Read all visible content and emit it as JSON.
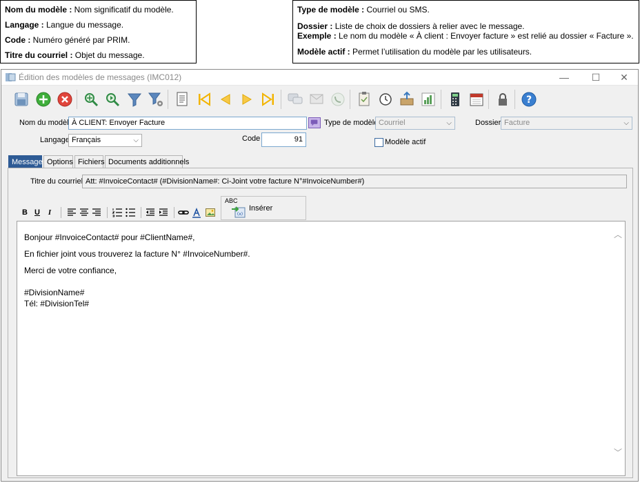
{
  "callouts": {
    "left": [
      {
        "term": "Nom du modèle :",
        "text": " Nom significatif du modèle."
      },
      {
        "term": "Langage :",
        "text": " Langue du message."
      },
      {
        "term": "Code :",
        "text": " Numéro généré par PRIM."
      },
      {
        "term": "Titre du courriel :",
        "text": " Objet du message."
      }
    ],
    "right": [
      {
        "term": "Type de modèle :",
        "text": " Courriel ou SMS."
      },
      {
        "term": "Dossier :",
        "text": " Liste de choix de dossiers à relier avec le message."
      },
      {
        "term": "Exemple :",
        "text": " Le nom du modèle « À client : Envoyer facture » est relié au dossier « Facture »."
      },
      {
        "term": "Modèle actif :",
        "text": " Permet l’utilisation du modèle par les utilisateurs."
      }
    ]
  },
  "window": {
    "title": "Édition des modèles de messages (IMC012)",
    "controls": {
      "minimize": "—",
      "maximize": "☐",
      "close": "✕"
    }
  },
  "toolbar": {
    "buttons": [
      "save-icon",
      "add-icon",
      "delete-icon",
      "search-icon",
      "search-next-icon",
      "filter-icon",
      "filter-settings-icon",
      "report-icon",
      "first-record-icon",
      "previous-record-icon",
      "next-record-icon",
      "last-record-icon",
      "message-icon",
      "email-icon",
      "phone-icon",
      "clipboard-icon",
      "history-icon",
      "export-icon",
      "chart-icon",
      "calculator-icon",
      "calendar-icon",
      "lock-icon",
      "help-icon"
    ]
  },
  "form": {
    "nom_label": "Nom du modèle",
    "nom_value": "À CLIENT: Envoyer Facture",
    "langage_label": "Langage",
    "langage_value": "Français",
    "code_label": "Code",
    "code_value": "91",
    "type_label": "Type de modèle",
    "type_value": "Courriel",
    "dossier_label": "Dossier",
    "dossier_value": "Facture",
    "actif_label": "Modèle actif",
    "actif_checked": false
  },
  "tabs": [
    "Message",
    "Options",
    "Fichiers",
    "Documents additionnels"
  ],
  "message": {
    "subject_label": "Titre du courriel",
    "subject_value": "Att: #InvoiceContact# (#DivisionName#: Ci-Joint votre facture N°#InvoiceNumber#)",
    "format_buttons": {
      "bold": "B",
      "underline": "U",
      "italic": "I"
    },
    "insert_label": "Insérer",
    "insert_icon_text": "ABC",
    "body_lines": [
      "Bonjour #InvoiceContact# pour #ClientName#,",
      "En fichier joint vous trouverez la facture N° #InvoiceNumber#.",
      "Merci de votre confiance,",
      "#DivisionName#",
      "Tél: #DivisionTel#"
    ]
  },
  "colors": {
    "accent": "#2e5b95",
    "field_border": "#7aa7cf"
  }
}
